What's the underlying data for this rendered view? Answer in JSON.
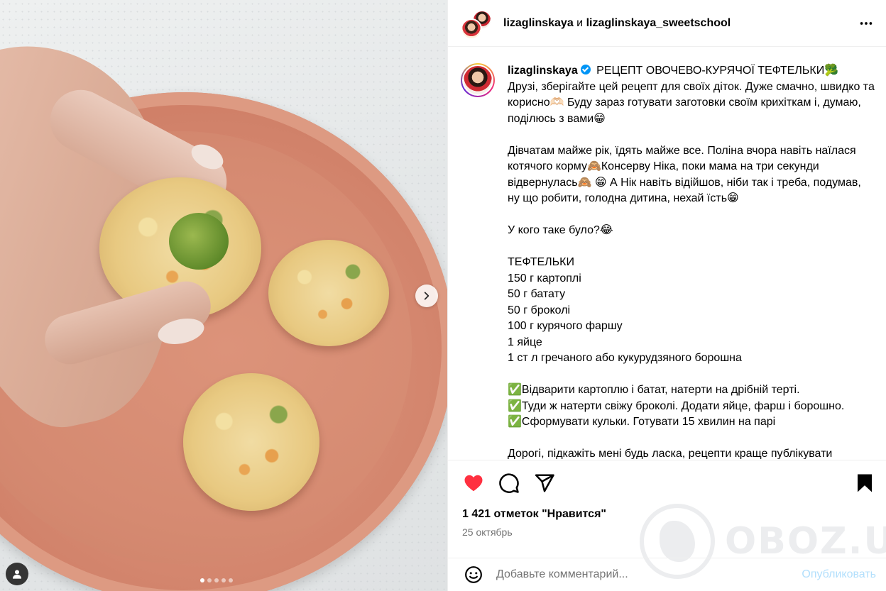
{
  "post": {
    "header": {
      "author": "lizaglinskaya",
      "and_word": "и",
      "coauthor": "lizaglinskaya_sweetschool",
      "more_icon": "more-horizontal-icon"
    },
    "photo": {
      "description_icon": "food-photo",
      "carousel_dots": 5,
      "active_dot": 1,
      "next_icon": "chevron-right-icon",
      "tag_icon": "user-tag-icon"
    },
    "caption": {
      "username": "lizaglinskaya",
      "title": "РЕЦЕПТ ОВОЧЕВО-КУРЯЧОЇ ТЕФТЕЛЬКИ🥦",
      "p1": "Друзі, зберігайте цей рецепт для своїх діток. Дуже смачно, швидко та корисно🫶🏻 Буду зараз готувати заготовки своїм крихіткам і, думаю, поділюсь з вами😁",
      "p2": "Дівчатам майже рік, їдять майже все. Поліна вчора навіть наїлася котячого корму🙈Консерву Ніка, поки мама на три секунди відвернулась🙈 😁 А Нік навіть відійшов, ніби так і треба, подумав, ну що робити, голодна дитина, нехай їсть😁",
      "p3": "У кого таке було?😂",
      "ingredients_title": "ТЕФТЕЛЬКИ",
      "ingredients": [
        "150 г картоплі",
        "50 г батату",
        "50 г броколі",
        "100 г курячого фаршу",
        "1 яйце",
        "1 ст л гречаного або кукурудзяного борошна"
      ],
      "steps": [
        "✅Відварити картоплю і батат, натерти на дрібній терті.",
        "✅Туди ж натерти свіжу броколі. Додати яйце, фарш і борошно.",
        "✅Сформувати кульки. Готувати 15 хвилин на парі"
      ],
      "truncated": "Дорогі, підкажіть мені будь ласка, рецепти краще публікувати"
    },
    "actions": {
      "like_icon": "heart-filled-icon",
      "comment_icon": "comment-icon",
      "share_icon": "share-icon",
      "save_icon": "bookmark-filled-icon",
      "like_color": "#ff3040"
    },
    "likes": "1 421 отметок \"Нравится\"",
    "date": "25 октябрь",
    "watermark": "OBOZ.UA",
    "comment": {
      "emoji_icon": "emoji-icon",
      "placeholder": "Добавьте комментарий...",
      "value": "",
      "publish": "Опубликовать"
    }
  }
}
